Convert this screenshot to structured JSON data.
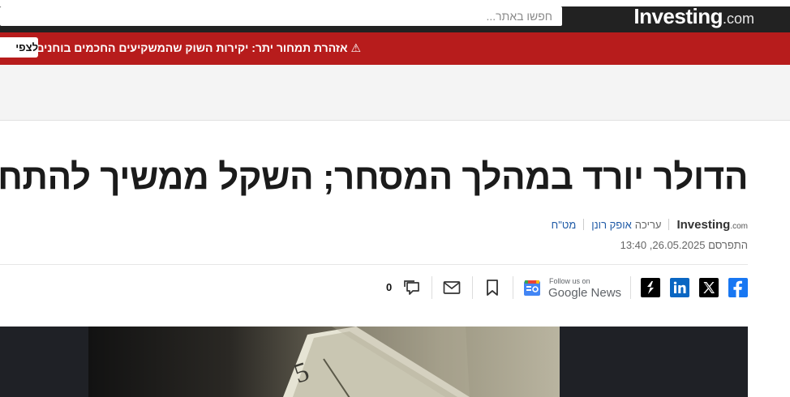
{
  "header": {
    "logo_brand": "Investing",
    "logo_suffix": ".com",
    "search_placeholder": "חפשו באתר..."
  },
  "alert": {
    "icon": "warning-icon",
    "text": "⚠ אזהרת תמחור יתר: יקירות השוק שהמשקיעים החכמים בוחנים מחדש",
    "button_label": "לצפי"
  },
  "article": {
    "title": "הדולר יורד במהלך המסחר; השקל ממשיך להתחזק",
    "source_logo_brand": "Investing",
    "source_logo_suffix": ".com",
    "edit_label": "עריכה",
    "editor": "אופק רונן",
    "category": "מט\"ח",
    "published": "התפרסם 26.05.2025, 13:40"
  },
  "share": {
    "google_news_follow": "Follow us on",
    "google_news_name": "Google News",
    "comment_count": "0",
    "icons": [
      "facebook-icon",
      "x-icon",
      "linkedin-icon",
      "substack-icon",
      "google-news-icon",
      "bookmark-icon",
      "mail-icon",
      "comments-icon"
    ]
  },
  "colors": {
    "topbar": "#222222",
    "alert": "#b71c1c",
    "link": "#1f5aa6",
    "facebook": "#1877f2",
    "linkedin": "#0a66c2"
  }
}
